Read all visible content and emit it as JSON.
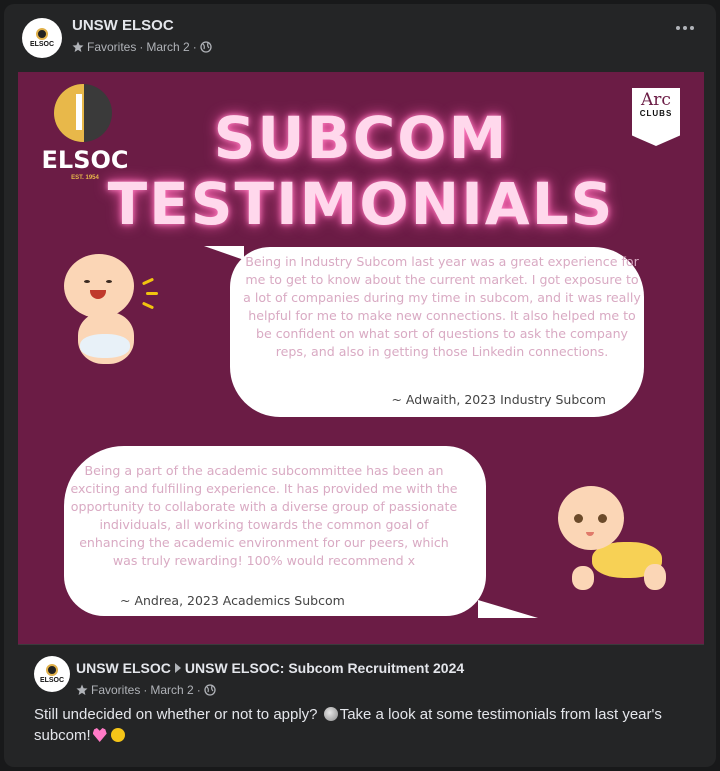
{
  "post": {
    "page_name": "UNSW ELSOC",
    "audience": "Favorites",
    "date": "March 2",
    "avatar_text": "ELSOC"
  },
  "graphic": {
    "logo_name": "ELSOC",
    "logo_est": "EST. 1954",
    "arc_top": "Arc",
    "arc_bottom": "CLUBS",
    "title_line1": "SUBCOM",
    "title_line2": "TESTIMONIALS",
    "testimonials": [
      {
        "text": "Being in Industry Subcom last year was a great experience for me to get to know about the current market. I got exposure to a lot of companies during my time in subcom, and it was really helpful for me to make new connections. It also helped me to be confident on what sort of questions to ask the company reps, and also in getting those Linkedin connections.",
        "author": "~ Adwaith, 2023 Industry Subcom"
      },
      {
        "text": "Being a part of the academic subcommittee has been an exciting and fulfilling experience. It has provided me with the opportunity to collaborate with a diverse group of passionate individuals, all working towards the common goal of enhancing the academic environment for our peers, which was truly rewarding! 100% would recommend x",
        "author": "~ Andrea, 2023 Academics Subcom"
      }
    ]
  },
  "shared": {
    "page_name": "UNSW ELSOC",
    "group_name": "UNSW ELSOC: Subcom Recruitment 2024",
    "audience": "Favorites",
    "date": "March 2",
    "text_part1": "Still undecided on whether or not to apply? ",
    "text_part2": "Take a look at some testimonials from last year's subcom!"
  },
  "icons": [
    "star-icon",
    "globe-icon",
    "more-options-icon",
    "arrow-right-icon"
  ]
}
